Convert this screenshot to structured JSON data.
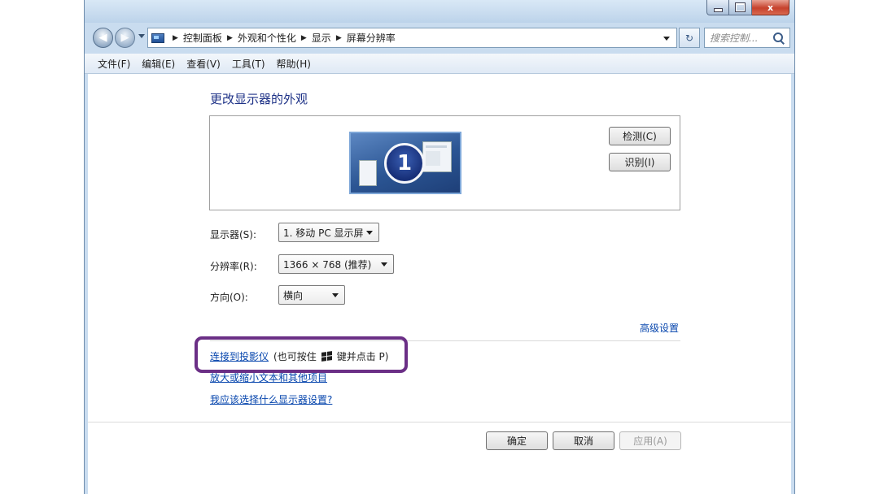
{
  "window": {
    "caption": {
      "close_glyph": "x"
    }
  },
  "address_bar": {
    "breadcrumbs": [
      "控制面板",
      "外观和个性化",
      "显示",
      "屏幕分辨率"
    ],
    "search_placeholder": "搜索控制...",
    "refresh_glyph": "↻"
  },
  "menu": {
    "items": [
      "文件(F)",
      "编辑(E)",
      "查看(V)",
      "工具(T)",
      "帮助(H)"
    ]
  },
  "main": {
    "heading": "更改显示器的外观",
    "monitor_number": "1",
    "detect_button": "检测(C)",
    "identify_button": "识别(I)",
    "display_label": "显示器(S):",
    "display_value": "1. 移动 PC 显示屏",
    "resolution_label": "分辨率(R):",
    "resolution_value": "1366 × 768 (推荐)",
    "orientation_label": "方向(O):",
    "orientation_value": "横向",
    "advanced_link": "高级设置",
    "projector_link": "连接到投影仪",
    "projector_hint_prefix": "(也可按住",
    "projector_hint_suffix": "键并点击 P)",
    "text_size_link": "放大或缩小文本和其他项目",
    "help_link": "我应该选择什么显示器设置?"
  },
  "footer": {
    "ok": "确定",
    "cancel": "取消",
    "apply": "应用(A)"
  },
  "colors": {
    "link": "#0645ad",
    "heading": "#1e3287",
    "highlight": "#6b2f86"
  }
}
